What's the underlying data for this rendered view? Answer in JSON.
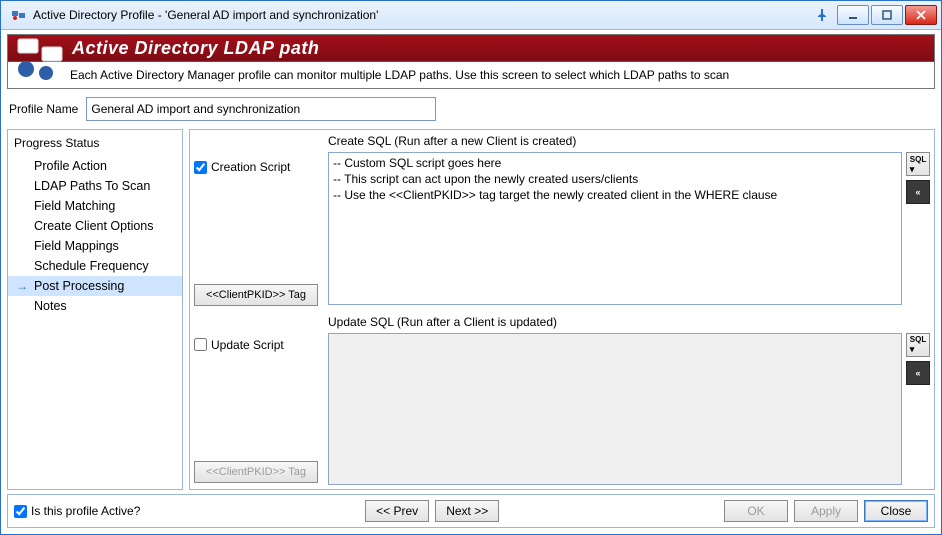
{
  "window": {
    "title": "Active Directory Profile - 'General AD import and synchronization'"
  },
  "banner": {
    "title": "Active Directory LDAP path",
    "subtitle": "Each Active Directory Manager profile can monitor multiple LDAP paths.  Use this screen to select which LDAP paths to scan"
  },
  "profile": {
    "label": "Profile Name",
    "value": "General AD import and synchronization"
  },
  "sidebar": {
    "title": "Progress Status",
    "items": [
      {
        "label": "Profile Action",
        "selected": false
      },
      {
        "label": "LDAP Paths To Scan",
        "selected": false
      },
      {
        "label": "Field Matching",
        "selected": false
      },
      {
        "label": "Create Client Options",
        "selected": false
      },
      {
        "label": "Field Mappings",
        "selected": false
      },
      {
        "label": "Schedule Frequency",
        "selected": false
      },
      {
        "label": "Post Processing",
        "selected": true
      },
      {
        "label": "Notes",
        "selected": false
      }
    ]
  },
  "main": {
    "create": {
      "checkbox": "Creation Script",
      "checked": true,
      "label": "Create SQL (Run after a new Client is created)",
      "script": "-- Custom SQL script goes here\n-- This script can act upon the newly created users/clients\n-- Use the <<ClientPKID>> tag target the newly created client in the WHERE clause",
      "tag_button": "<<ClientPKID>> Tag",
      "tag_enabled": true
    },
    "update": {
      "checkbox": "Update Script",
      "checked": false,
      "label": "Update SQL (Run after a Client is updated)",
      "script": "",
      "tag_button": "<<ClientPKID>> Tag",
      "tag_enabled": false
    }
  },
  "footer": {
    "active_label": "Is this profile Active?",
    "active_checked": true,
    "prev": "<< Prev",
    "next": "Next >>",
    "ok": "OK",
    "apply": "Apply",
    "close": "Close",
    "ok_enabled": false,
    "apply_enabled": false
  }
}
